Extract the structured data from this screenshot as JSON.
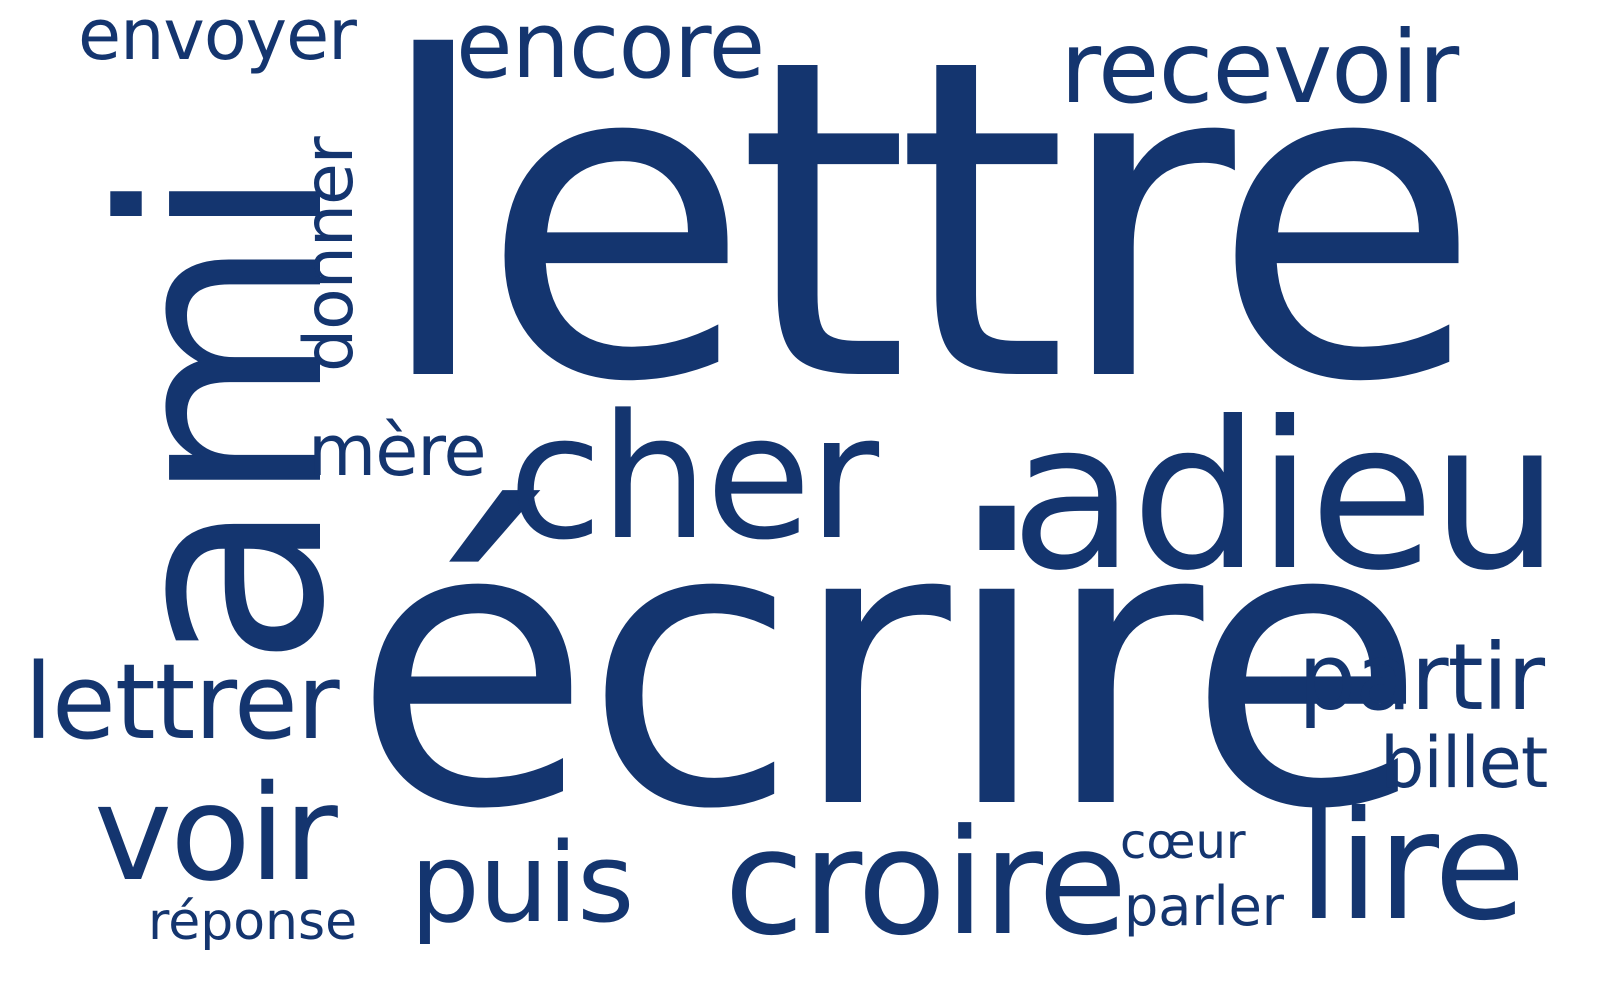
{
  "theme": {
    "word_color": "#14356f",
    "background": "#ffffff"
  },
  "words": {
    "lettre": "lettre",
    "ecrire": "écrire",
    "ami": "ami",
    "adieu": "adieu",
    "cher": "cher",
    "croire": "croire",
    "lire": "lire",
    "voir": "voir",
    "recevoir": "recevoir",
    "encore": "encore",
    "lettrer": "lettrer",
    "puis": "puis",
    "partir": "partir",
    "envoyer": "envoyer",
    "mere": "mère",
    "billet": "billet",
    "reponse": "réponse",
    "coeur": "cœur",
    "parler": "parler",
    "donner": "donner"
  }
}
